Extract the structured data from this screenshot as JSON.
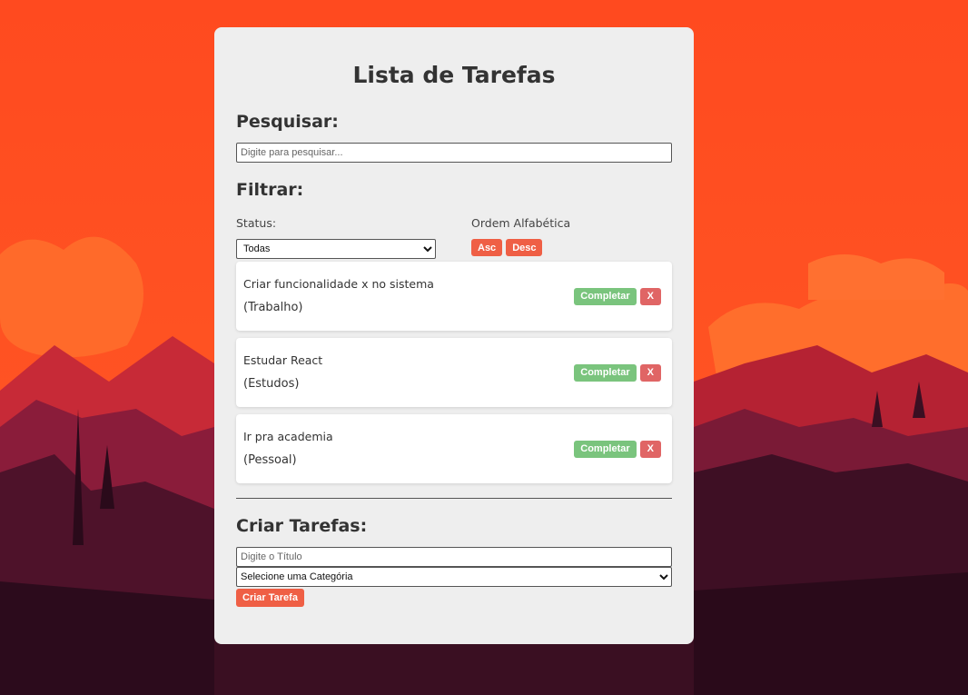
{
  "colors": {
    "sky_top": "#ff4a1f",
    "sky_bottom": "#ff5a24",
    "card_bg": "#eeeeee",
    "accent_red": "#ef5f45",
    "complete_green": "#7ac47d",
    "delete_red": "#e06565"
  },
  "app": {
    "title": "Lista de Tarefas"
  },
  "search": {
    "heading": "Pesquisar:",
    "placeholder": "Digite para pesquisar..."
  },
  "filter": {
    "heading": "Filtrar:",
    "status_label": "Status:",
    "status_selected": "Todas",
    "order_label": "Ordem Alfabética",
    "asc_label": "Asc",
    "desc_label": "Desc"
  },
  "tasks": [
    {
      "title": "Criar funcionalidade x no sistema",
      "category": "(Trabalho)",
      "complete_label": "Completar",
      "delete_label": "X"
    },
    {
      "title": "Estudar React",
      "category": "(Estudos)",
      "complete_label": "Completar",
      "delete_label": "X"
    },
    {
      "title": "Ir pra academia",
      "category": "(Pessoal)",
      "complete_label": "Completar",
      "delete_label": "X"
    }
  ],
  "create": {
    "heading": "Criar Tarefas:",
    "title_placeholder": "Digite o Título",
    "category_selected": "Selecione uma Categória",
    "submit_label": "Criar Tarefa"
  }
}
